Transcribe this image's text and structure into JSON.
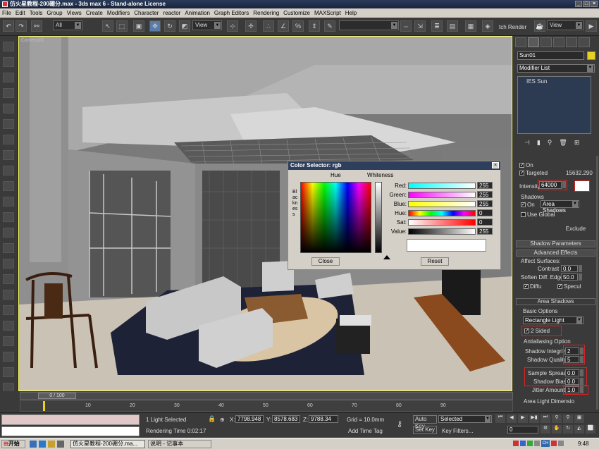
{
  "window": {
    "title": "仿火星教程-200硼分.max - 3ds max 6 - Stand-alone License"
  },
  "menu": [
    "File",
    "Edit",
    "Tools",
    "Group",
    "Views",
    "Create",
    "Modifiers",
    "Character",
    "reactor",
    "Animation",
    "Graph Editors",
    "Rendering",
    "Customize",
    "MAXScript",
    "Help"
  ],
  "toolbar": {
    "selection_filter": "All",
    "ref_coord": "View",
    "render_label": "tch Render",
    "view_dropdown": "View"
  },
  "viewport": {
    "label": "Camera01"
  },
  "command_panel": {
    "object_name": "Sun01",
    "modifier_list": "Modifier List",
    "stack_item": "IES Sun",
    "on_label": "On",
    "target_label": "Targeted",
    "target_value": "15632.290",
    "intensity_label": "Intensity",
    "intensity_value": "64000",
    "shadows_title": "Shadows",
    "shadows_on": "On",
    "shadow_type": "Area Shadows",
    "use_global": "Use Global",
    "exclude": "Exclude",
    "shadow_params": "Shadow Parameters",
    "advanced_effects": "Advanced Effects",
    "affect_surfaces": "Affect Surfaces:",
    "contrast_label": "Contrast",
    "contrast_value": "0.0",
    "soften_label": "Soften Diff. Edge",
    "soften_value": "50.0",
    "diffuse": "Diffu",
    "specular": "Specul",
    "area_shadows": "Area Shadows",
    "basic_options": "Basic Options",
    "rect_light": "Rectangle Light",
    "two_sided": "2 Sided",
    "antialias": "Antialiasing Option",
    "shadow_integrity_label": "Shadow Integrity",
    "shadow_integrity_value": "2",
    "shadow_quality_label": "Shadow Quality",
    "shadow_quality_value": "5",
    "sample_spread_label": "Sample Spread",
    "sample_spread_value": "0.0",
    "shadow_bias_label": "Shadow Bias",
    "shadow_bias_value": "0.0",
    "jitter_label": "Jitter Amount",
    "jitter_value": "1.0",
    "area_light_dim": "Area Light Dimensio"
  },
  "color_selector": {
    "title": "Color Selector: rgb",
    "hue_header": "Hue",
    "whiteness_header": "Whiteness",
    "blackness": "Blackness",
    "sliders": [
      {
        "label": "Red:",
        "value": "255"
      },
      {
        "label": "Green:",
        "value": "255"
      },
      {
        "label": "Blue:",
        "value": "255"
      },
      {
        "label": "Hue:",
        "value": "0"
      },
      {
        "label": "Sat:",
        "value": "0"
      },
      {
        "label": "Value:",
        "value": "255"
      }
    ],
    "close": "Close",
    "reset": "Reset"
  },
  "timeline": {
    "frame": "0 / 100",
    "ticks": [
      "10",
      "20",
      "30",
      "40",
      "50",
      "60",
      "70",
      "80",
      "90"
    ]
  },
  "status": {
    "selection": "1 Light Selected",
    "rendering_time": "Rendering Time  0:02:17",
    "x_label": "X:",
    "x": "7798.948",
    "y_label": "Y:",
    "y": "8578.683",
    "z_label": "Z:",
    "z": "9788.34",
    "grid": "Grid = 10.0mm",
    "add_time_tag": "Add Time Tag",
    "auto_key": "Auto Key",
    "set_key": "Set Key",
    "selected": "Selected",
    "key_filters": "Key Filters...",
    "frame_field": "0"
  },
  "taskbar": {
    "start": "开始",
    "task1": "仿火星教程-200硼分.ma...",
    "task2": "说明 - 记事本",
    "clock": "9:48",
    "lang": "CH"
  }
}
